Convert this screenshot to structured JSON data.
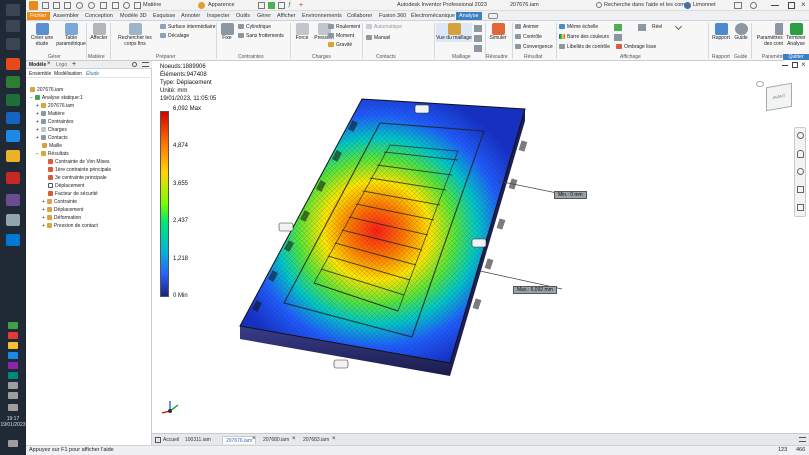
{
  "titlebar": {
    "material": "Matière",
    "appearance": "Apparence",
    "app_title": "Autodesk Inventor Professional 2023",
    "document": "207676.iam",
    "help_search": "Recherche dans l'aide et les com",
    "user": "Limonnet"
  },
  "menu": {
    "tabs": [
      "Fichier",
      "Assembler",
      "Conception",
      "Modèle 3D",
      "Esquisse",
      "Annoter",
      "Inspecter",
      "Outils",
      "Gérer",
      "Afficher",
      "Environnements",
      "Collaborer",
      "Fusion 360",
      "Électromécanique",
      "Analyse"
    ],
    "active_tab": "Analyse"
  },
  "ribbon": {
    "creer_etude": "Créer une étude",
    "table_parametrique": "Table paramétrique",
    "affecter": "Affecter",
    "rechercher_corps": "Rechercher les corps fins",
    "surface_intermediaire": "Surface intermédiaire",
    "decalage": "Décalage",
    "fixe": "Fixe",
    "cylindrique": "Cylindrique",
    "sans_frottements": "Sans frottements",
    "force": "Force",
    "pression": "Pression",
    "roulement": "Roulement",
    "moment": "Moment",
    "gravite": "Gravité",
    "automatique": "Automatique",
    "manuel": "Manuel",
    "vue_maillage": "Vue du maillage",
    "simuler": "Simuler",
    "animer": "Animer",
    "controle": "Contrôle",
    "convergence": "Convergence",
    "meme_echelle": "Même échelle",
    "barre_couleurs": "Barre des couleurs",
    "libelles_controle": "Libellés de contrôle",
    "ombrage_lisse": "Ombrage lisse",
    "reel": "Réel",
    "rapport": "Rapport",
    "guide": "Guide",
    "parametres": "Paramètres d'analyse des contraintes",
    "terminer": "Terminer Analyse",
    "groups": {
      "gerer": "Gérer",
      "matiere": "Matière",
      "preparer": "Préparer",
      "contraintes": "Contraintes",
      "charges": "Charges",
      "contacts": "Contacts",
      "maillage": "Maillage",
      "resoudre": "Résoudre",
      "resultat": "Résultat",
      "affichage": "Affichage",
      "rapport": "Rapport",
      "guide": "Guide",
      "parametres": "Paramètres",
      "quitter": "Quitter"
    }
  },
  "browser": {
    "tab_modele": "Modèle",
    "tab_logo": "Logo",
    "view_ensemble": "Ensemble",
    "view_modelisation": "Modélisation",
    "view_etude": "Étude",
    "tree": [
      {
        "label": "207676.iam",
        "depth": 0
      },
      {
        "label": "Analyse statique:1",
        "depth": 1
      },
      {
        "label": "207676.iam",
        "depth": 2
      },
      {
        "label": "Matière",
        "depth": 2
      },
      {
        "label": "Contraintes",
        "depth": 2
      },
      {
        "label": "Charges",
        "depth": 2
      },
      {
        "label": "Contacts",
        "depth": 2
      },
      {
        "label": "Maille",
        "depth": 2
      },
      {
        "label": "Résultats",
        "depth": 2
      },
      {
        "label": "Contrainte de Von Mises",
        "depth": 3
      },
      {
        "label": "1ère contrainte principale",
        "depth": 3
      },
      {
        "label": "3e contrainte principale",
        "depth": 3
      },
      {
        "label": "Déplacement",
        "depth": 3
      },
      {
        "label": "Facteur de sécurité",
        "depth": 3
      },
      {
        "label": "Contrainte",
        "depth": 2
      },
      {
        "label": "Déplacement",
        "depth": 2
      },
      {
        "label": "Déformation",
        "depth": 2
      },
      {
        "label": "Pression de contact",
        "depth": 2
      }
    ]
  },
  "viewport": {
    "nodes": "Noeuds:1889906",
    "elements": "Éléments:947408",
    "type": "Type: Déplacement",
    "unit": "Unité: mm",
    "datetime": "19/01/2023, 11:05:05",
    "legend": [
      "6,092 Max",
      "4,874",
      "3,655",
      "2,437",
      "1,218",
      "0 Min"
    ],
    "callout_min": "Min.: 0 mm",
    "callout_max": "Max.: 6,092 mm",
    "viewcube": "AVANT"
  },
  "doctabs": {
    "home": "Accueil",
    "tabs": [
      "100311.iam",
      "207676.iam",
      "207680.iam",
      "207683.iam"
    ],
    "active": "207676.iam"
  },
  "status": {
    "help": "Appuyez sur F1 pour afficher l'aide",
    "count1": "123",
    "count2": "466"
  },
  "clock": {
    "time": "19:17",
    "date": "19/01/2023"
  }
}
